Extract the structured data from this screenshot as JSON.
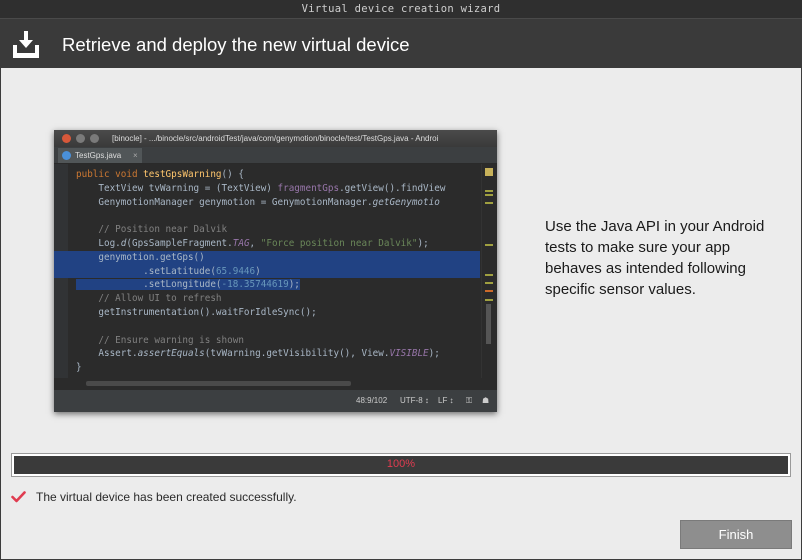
{
  "window": {
    "title": "Virtual device creation wizard"
  },
  "header": {
    "title": "Retrieve and deploy the new virtual device",
    "icon": "download-tray-icon"
  },
  "screenshot": {
    "title": "[binocle] - .../binocle/src/androidTest/java/com/genymotion/binocle/test/TestGps.java - Androi",
    "tab": "TestGps.java",
    "status": {
      "position": "48:9/102",
      "encoding": "UTF-8 ↕",
      "line_sep": "LF ↕"
    }
  },
  "description": "Use the Java API in your Android tests to make sure your app behaves as intended following specific sensor values.",
  "progress": {
    "value": 1.0,
    "label": "100%"
  },
  "status_message": "The virtual device has been created successfully.",
  "buttons": {
    "finish": "Finish"
  },
  "colors": {
    "accent": "#e03c50",
    "header_bg": "#3a3a3a",
    "content_bg": "#ececec"
  }
}
